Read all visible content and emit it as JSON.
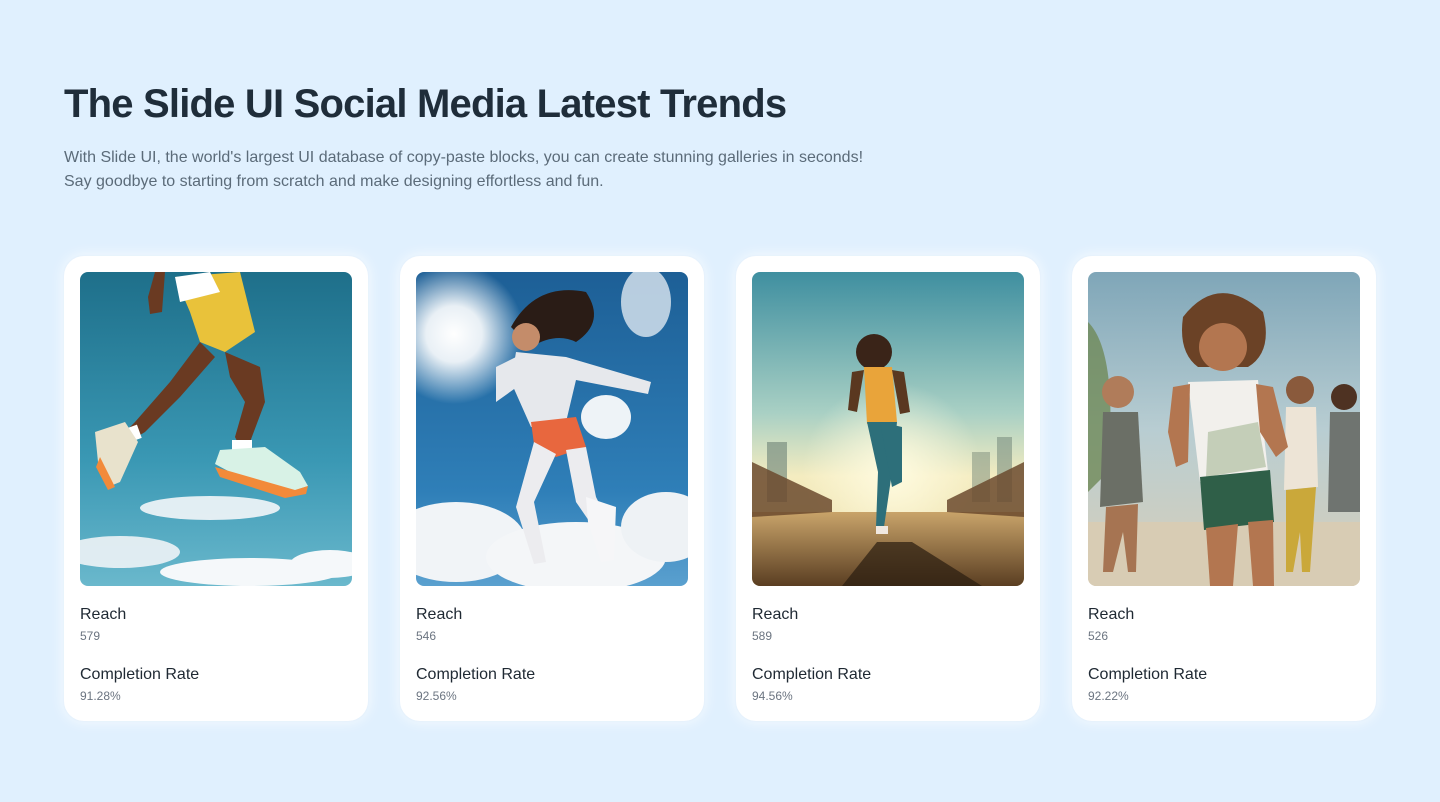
{
  "header": {
    "title": "The Slide UI Social Media Latest Trends",
    "subtitle": "With Slide UI, the world's largest UI database of copy-paste blocks, you can create stunning galleries in seconds! Say goodbye to starting from scratch and make designing effortless and fun."
  },
  "cards": [
    {
      "image": "runner-jumping-legs-photo",
      "reach_label": "Reach",
      "reach_value": "579",
      "completion_label": "Completion Rate",
      "completion_value": "91.28%"
    },
    {
      "image": "woman-leaping-sky-photo",
      "reach_label": "Reach",
      "reach_value": "546",
      "completion_label": "Completion Rate",
      "completion_value": "92.56%"
    },
    {
      "image": "woman-running-bridge-photo",
      "reach_label": "Reach",
      "reach_value": "589",
      "completion_label": "Completion Rate",
      "completion_value": "94.56%"
    },
    {
      "image": "group-running-women-photo",
      "reach_label": "Reach",
      "reach_value": "526",
      "completion_label": "Completion Rate",
      "completion_value": "92.22%"
    }
  ],
  "colors": {
    "background": "#e0f0fe",
    "card": "#ffffff",
    "title": "#1f2d3a",
    "subtitle": "#5b6b79"
  }
}
